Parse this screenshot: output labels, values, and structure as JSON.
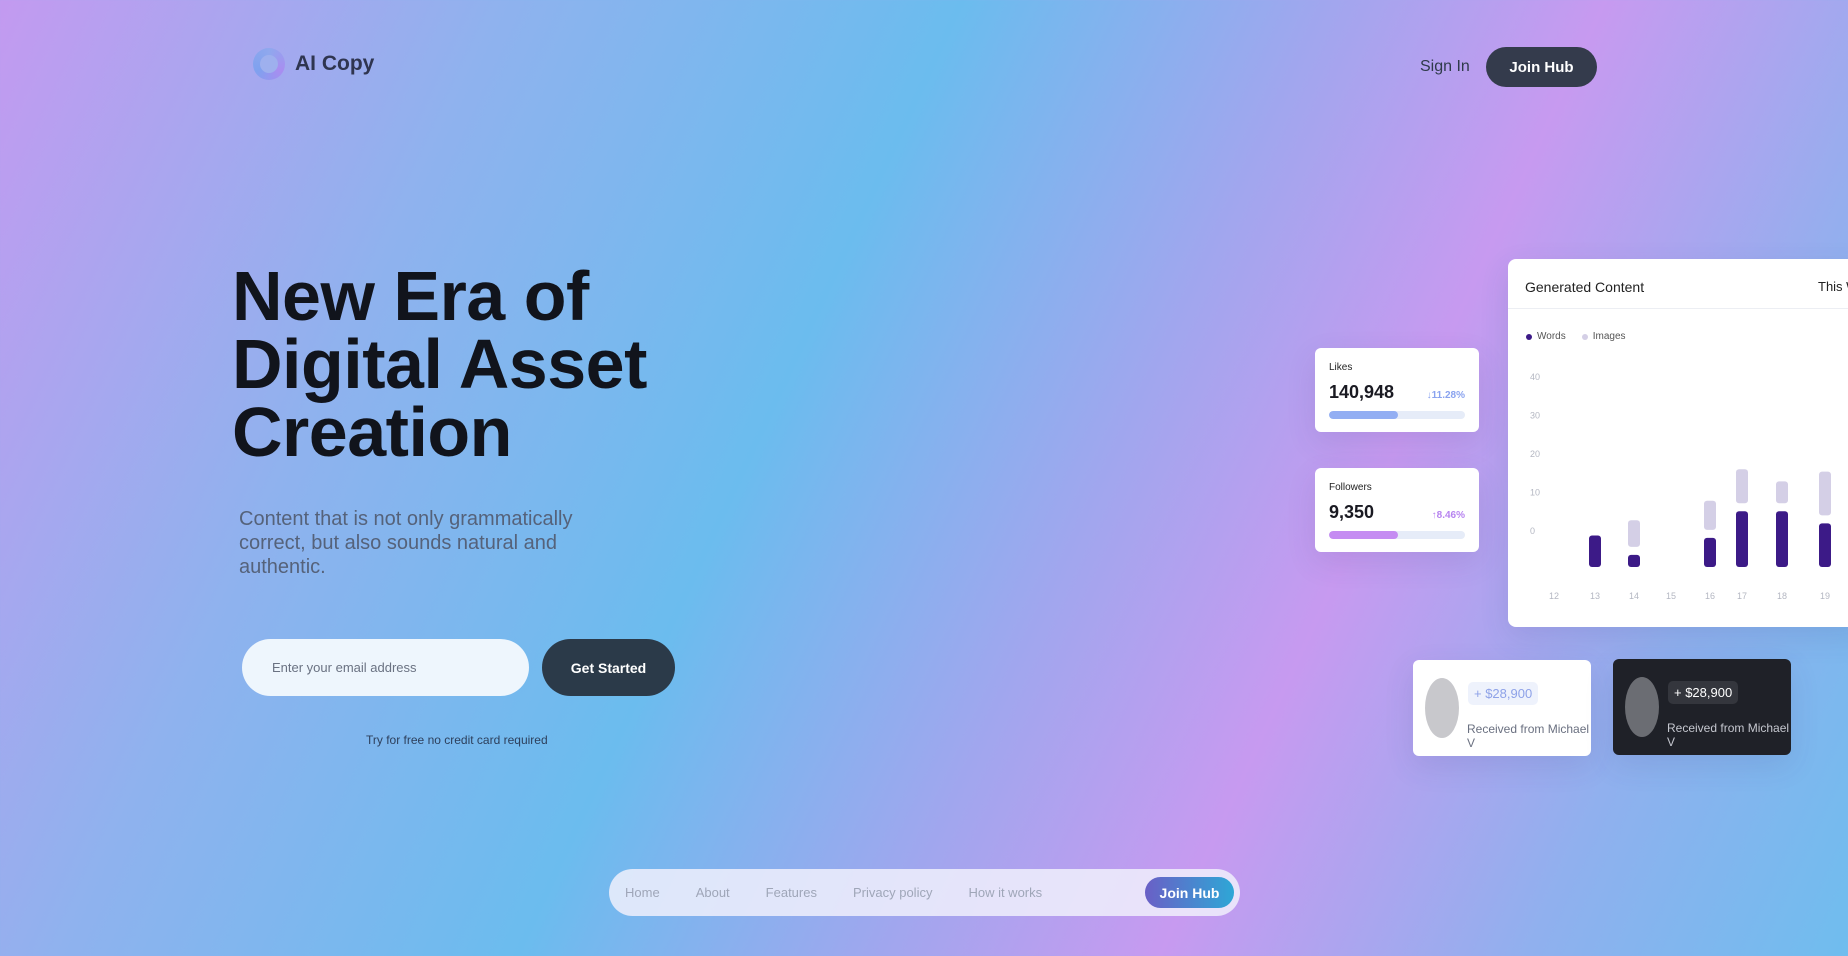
{
  "brand": {
    "name": "AI Copy"
  },
  "header": {
    "sign_in": "Sign In",
    "join": "Join Hub"
  },
  "hero": {
    "title_lines": [
      "New Era of",
      "Digital Asset",
      "Creation"
    ],
    "subtitle": "Content that is not only grammatically correct, but also sounds natural and authentic.",
    "email_placeholder": "Enter your email address",
    "cta": "Get Started",
    "note": "Try for free no credit card required"
  },
  "stats": [
    {
      "label": "Likes",
      "value": "140,948",
      "change": "11.28%",
      "direction": "down",
      "progress": 0.51,
      "color": "#92aef3",
      "change_color": "#8aa3ef"
    },
    {
      "label": "Followers",
      "value": "9,350",
      "change": "8.46%",
      "direction": "up",
      "progress": 0.51,
      "color": "#c58cf2",
      "change_color": "#b783f0"
    }
  ],
  "chart": {
    "title": "Generated Content",
    "period": "This W",
    "legend": [
      {
        "name": "Words",
        "color": "#3c1a87"
      },
      {
        "name": "Images",
        "color": "#d4cfe6"
      }
    ]
  },
  "chart_data": {
    "type": "bar",
    "title": "Generated Content",
    "categories": [
      "12",
      "13",
      "14",
      "15",
      "16",
      "17",
      "18",
      "19"
    ],
    "yticks": [
      "40",
      "30",
      "20",
      "10",
      "0"
    ],
    "ylim": [
      0,
      40
    ],
    "series": [
      {
        "name": "Words",
        "values": [
          0,
          13,
          5,
          0,
          12,
          23,
          23,
          18
        ]
      },
      {
        "name": "Images",
        "values": [
          0,
          0,
          11,
          0,
          12,
          14,
          9,
          18
        ]
      }
    ],
    "legend_position": "top-left"
  },
  "payments": [
    {
      "amount": "+ $28,900",
      "from": "Received from Michael V",
      "theme": "light"
    },
    {
      "amount": "+ $28,900",
      "from": "Received from Michael V",
      "theme": "dark"
    }
  ],
  "bottom_nav": {
    "items": [
      "Home",
      "About",
      "Features",
      "Privacy policy",
      "How it works"
    ],
    "join": "Join Hub"
  }
}
